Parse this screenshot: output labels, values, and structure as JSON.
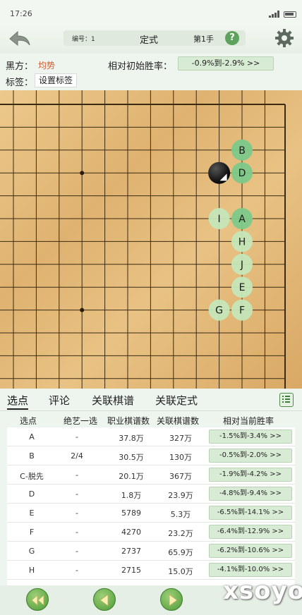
{
  "status_bar": {
    "time": "17:26"
  },
  "header": {
    "number_label": "编号：1",
    "title": "定式",
    "move_label": "第1手"
  },
  "info": {
    "black_label": "黑方：",
    "black_value": "均势",
    "rate_label": "相对初始胜率：",
    "rate_value": "-0.9%到-2.9% >>",
    "tag_label": "标签：",
    "tag_button": "设置标签"
  },
  "board": {
    "stones": [
      {
        "color": "black",
        "col": 9,
        "row": 3,
        "last_move": true
      }
    ],
    "candidates": [
      {
        "label": "B",
        "col": 10,
        "row": 2,
        "primary": true
      },
      {
        "label": "D",
        "col": 10,
        "row": 3,
        "primary": true
      },
      {
        "label": "I",
        "col": 9,
        "row": 5,
        "primary": false
      },
      {
        "label": "A",
        "col": 10,
        "row": 5,
        "primary": true
      },
      {
        "label": "H",
        "col": 10,
        "row": 6,
        "primary": false
      },
      {
        "label": "J",
        "col": 10,
        "row": 7,
        "primary": false
      },
      {
        "label": "E",
        "col": 10,
        "row": 8,
        "primary": false
      },
      {
        "label": "G",
        "col": 9,
        "row": 9,
        "primary": false
      },
      {
        "label": "F",
        "col": 10,
        "row": 9,
        "primary": false
      }
    ],
    "star_points": [
      {
        "col": 3,
        "row": 3
      },
      {
        "col": 3,
        "row": 9
      }
    ]
  },
  "tabs": [
    {
      "label": "选点",
      "active": true
    },
    {
      "label": "评论",
      "active": false
    },
    {
      "label": "关联棋谱",
      "active": false
    },
    {
      "label": "关联定式",
      "active": false
    }
  ],
  "table": {
    "headers": [
      "选点",
      "绝艺一选",
      "职业棋谱数",
      "关联棋谱数",
      "相对当前胜率"
    ],
    "rows": [
      [
        "A",
        "-",
        "37.8万",
        "327万",
        "-1.5%到-3.4% >>"
      ],
      [
        "B",
        "2/4",
        "30.5万",
        "130万",
        "-0.5%到-2.0% >>"
      ],
      [
        "C-脱先",
        "-",
        "20.1万",
        "367万",
        "-1.9%到-4.2% >>"
      ],
      [
        "D",
        "-",
        "1.8万",
        "23.9万",
        "-4.8%到-9.4% >>"
      ],
      [
        "E",
        "-",
        "5789",
        "5.3万",
        "-6.5%到-14.1% >>"
      ],
      [
        "F",
        "-",
        "4270",
        "23.2万",
        "-6.4%到-12.9% >>"
      ],
      [
        "G",
        "-",
        "2737",
        "65.9万",
        "-6.2%到-10.6% >>"
      ],
      [
        "H",
        "-",
        "2715",
        "15.0万",
        "-4.1%到-10.0% >>"
      ]
    ]
  },
  "watermark": "xsoyo",
  "colors": {
    "accent": "#5da35d",
    "candidate_primary": "#7cc98a",
    "candidate_secondary": "#c4e6b8",
    "rate_text": "#d65a2a"
  }
}
